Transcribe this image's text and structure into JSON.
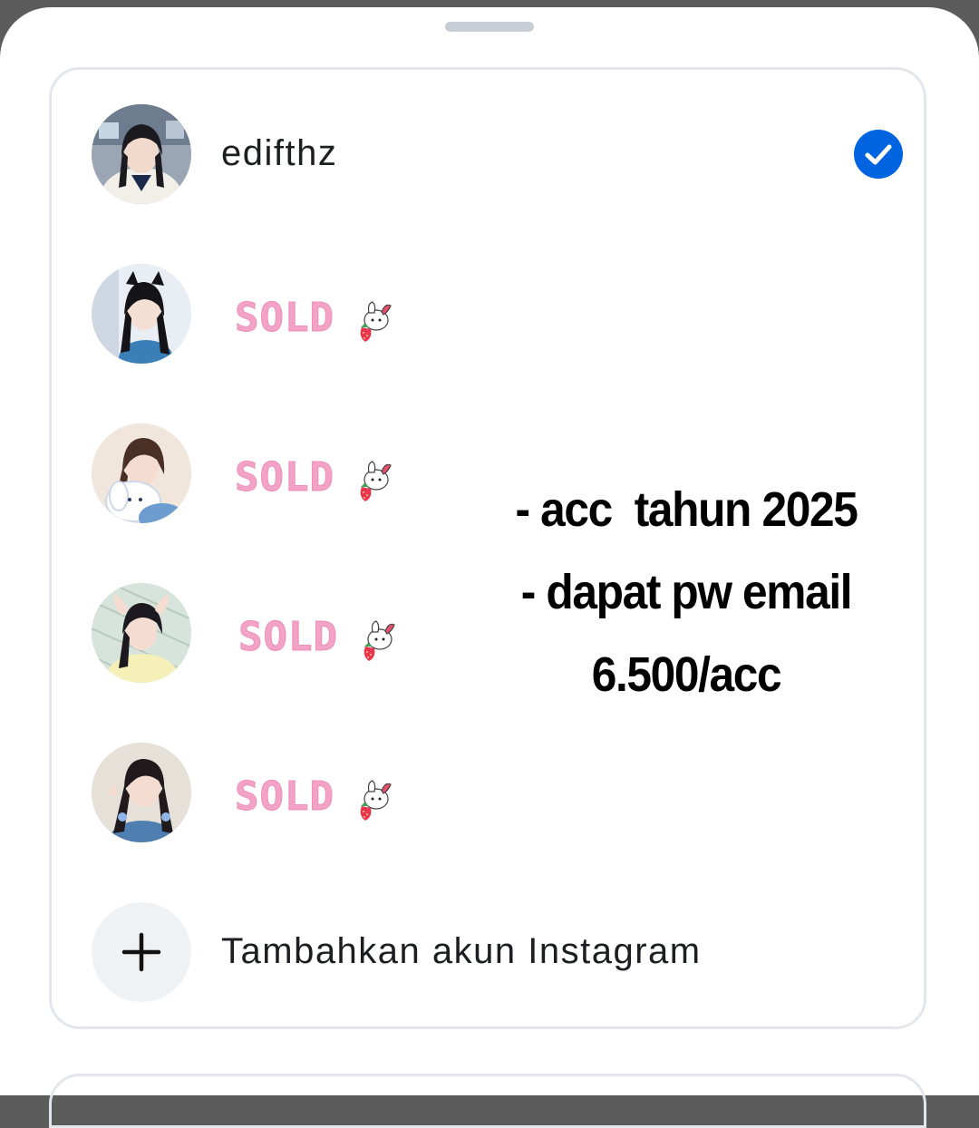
{
  "sheet": {
    "accounts": [
      {
        "username": "edifthz",
        "selected": true
      },
      {
        "username": "SOLD",
        "sold": true
      },
      {
        "username": "SOLD",
        "sold": true
      },
      {
        "username": "SOLD",
        "sold": true
      },
      {
        "username": "SOLD",
        "sold": true
      }
    ],
    "add_account_label": "Tambahkan akun Instagram"
  },
  "promo": {
    "line1": "- acc  tahun 2025",
    "line2": "- dapat pw email",
    "line3": "6.500/acc"
  },
  "colors": {
    "check_blue": "#0064e0",
    "sold_pink": "#f2a3c6"
  },
  "icons": {
    "check": "check-circle-icon",
    "add": "plus-icon",
    "sticker": "bunny-strawberry-sticker"
  }
}
